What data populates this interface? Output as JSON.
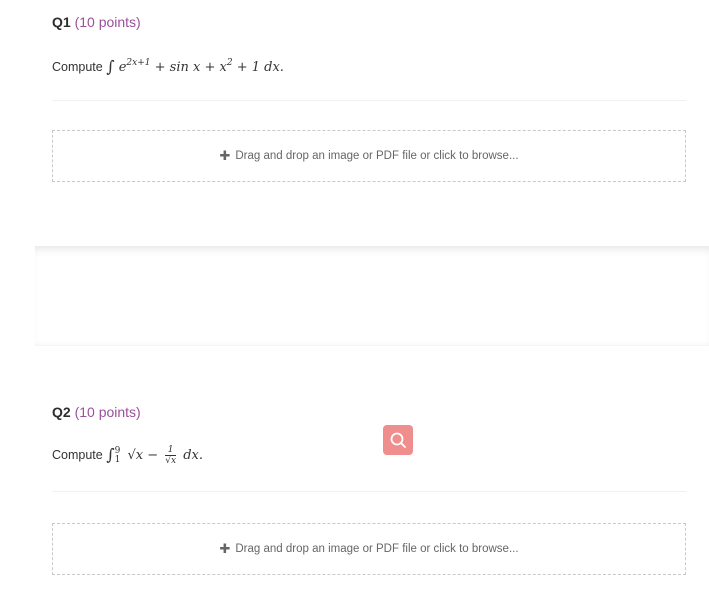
{
  "questions": [
    {
      "number": "Q1",
      "points": "(10 points)",
      "prompt_prefix": "Compute",
      "math": {
        "integral": "∫",
        "base": "e",
        "exponent": "2x+1",
        "rest": "+ sin x + x",
        "rest_exponent": "2",
        "tail": "+ 1 dx."
      },
      "dropzone_label": "Drag and drop an image or PDF file or click to browse..."
    },
    {
      "number": "Q2",
      "points": "(10 points)",
      "prompt_prefix": "Compute",
      "math": {
        "integral": "∫",
        "upper": "9",
        "lower": "1",
        "sqrt": "√x",
        "minus": "−",
        "frac_num": "1",
        "frac_den": "√x",
        "tail": "dx."
      },
      "dropzone_label": "Drag and drop an image or PDF file or click to browse..."
    }
  ],
  "icons": {
    "dropzone_plus": "plus-icon",
    "search": "search-icon"
  },
  "colors": {
    "points_text": "#9c4f9a",
    "search_button": "#f08d8d",
    "dropzone_border": "#c9c9c9"
  }
}
